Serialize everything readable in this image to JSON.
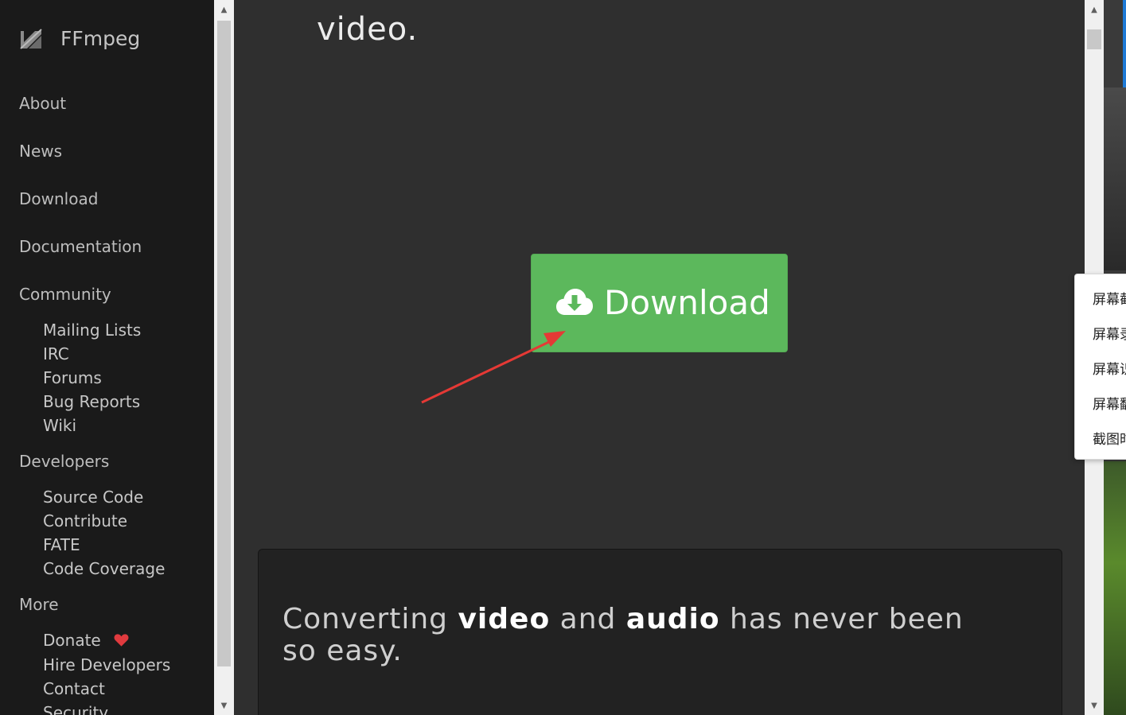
{
  "sidebar": {
    "brand": "FFmpeg",
    "nav": [
      {
        "label": "About",
        "type": "top"
      },
      {
        "label": "News",
        "type": "top"
      },
      {
        "label": "Download",
        "type": "top"
      },
      {
        "label": "Documentation",
        "type": "top"
      },
      {
        "label": "Community",
        "type": "top"
      },
      {
        "label": "Mailing Lists",
        "type": "sub"
      },
      {
        "label": "IRC",
        "type": "sub"
      },
      {
        "label": "Forums",
        "type": "sub"
      },
      {
        "label": "Bug Reports",
        "type": "sub"
      },
      {
        "label": "Wiki",
        "type": "sub"
      },
      {
        "label": "Developers",
        "type": "top"
      },
      {
        "label": "Source Code",
        "type": "sub"
      },
      {
        "label": "Contribute",
        "type": "sub"
      },
      {
        "label": "FATE",
        "type": "sub"
      },
      {
        "label": "Code Coverage",
        "type": "sub"
      },
      {
        "label": "More",
        "type": "top"
      },
      {
        "label": "Donate",
        "type": "sub"
      },
      {
        "label": "Hire Developers",
        "type": "sub"
      },
      {
        "label": "Contact",
        "type": "sub"
      },
      {
        "label": "Security",
        "type": "sub"
      }
    ]
  },
  "main": {
    "top_text": "video.",
    "download_button": {
      "label": "Download",
      "icon": "cloud-download-icon"
    },
    "panel": {
      "segments": [
        {
          "text": "Converting ",
          "bold": false
        },
        {
          "text": "video",
          "bold": true
        },
        {
          "text": " and ",
          "bold": false
        },
        {
          "text": "audio",
          "bold": true
        },
        {
          "text": " has never been so easy.",
          "bold": false
        }
      ]
    }
  },
  "context_menu": {
    "items": [
      "屏幕截",
      "屏幕录",
      "屏幕识",
      "屏幕翻",
      "截图时"
    ]
  },
  "colors": {
    "sidebar_bg": "#1a1a1a",
    "main_bg": "#2f2f2f",
    "button_green": "#5cb85c",
    "heart_red": "#e03a3e",
    "annotation_arrow": "#e53935"
  }
}
